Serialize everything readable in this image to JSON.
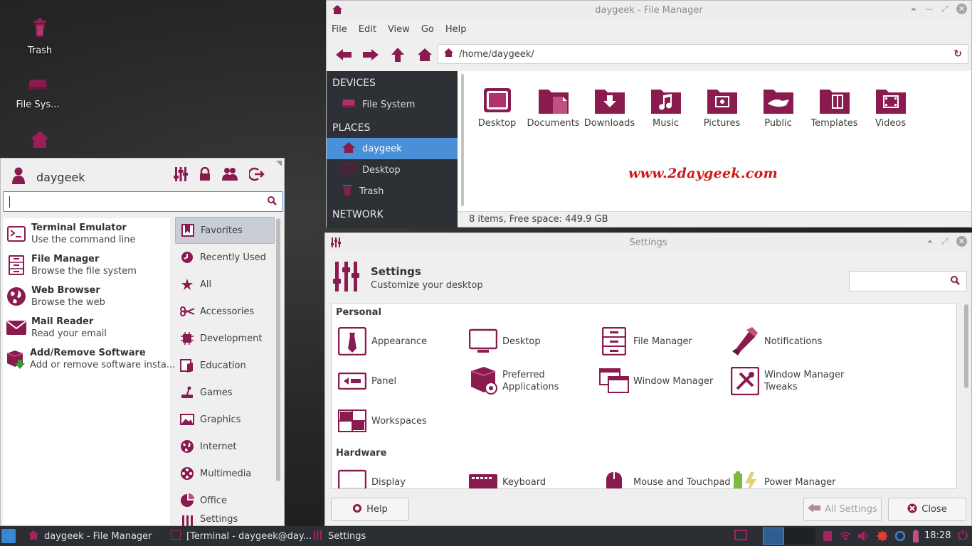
{
  "desktop": {
    "icons": [
      {
        "label": "Trash",
        "icon": "trash-icon"
      },
      {
        "label": "File Sys...",
        "icon": "drive-icon"
      },
      {
        "label": "",
        "icon": "home-icon"
      }
    ]
  },
  "file_manager": {
    "title": "daygeek - File Manager",
    "menu": [
      "File",
      "Edit",
      "View",
      "Go",
      "Help"
    ],
    "path": "/home/daygeek/",
    "sidebar": {
      "devices_header": "DEVICES",
      "devices": [
        "File System"
      ],
      "places_header": "PLACES",
      "places": [
        "daygeek",
        "Desktop",
        "Trash"
      ],
      "network_header": "NETWORK",
      "selected": "daygeek"
    },
    "folders": [
      "Desktop",
      "Documents",
      "Downloads",
      "Music",
      "Pictures",
      "Public",
      "Templates",
      "Videos"
    ],
    "watermark": "www.2daygeek.com",
    "status": "8 items, Free space: 449.9 GB"
  },
  "settings": {
    "window_title": "Settings",
    "header_title": "Settings",
    "header_subtitle": "Customize your desktop",
    "groups": {
      "personal": "Personal",
      "hardware": "Hardware"
    },
    "personal_items": [
      "Appearance",
      "Desktop",
      "File Manager",
      "Notifications",
      "Panel",
      "Preferred Applications",
      "Window Manager",
      "Window Manager Tweaks",
      "Workspaces"
    ],
    "hardware_items": [
      "Display",
      "Keyboard",
      "Mouse and Touchpad",
      "Power Manager"
    ],
    "buttons": {
      "help": "Help",
      "all_settings": "All Settings",
      "close": "Close"
    }
  },
  "menu": {
    "user": "daygeek",
    "search_value": "",
    "apps": [
      {
        "name": "Terminal Emulator",
        "desc": "Use the command line"
      },
      {
        "name": "File Manager",
        "desc": "Browse the file system"
      },
      {
        "name": "Web Browser",
        "desc": "Browse the web"
      },
      {
        "name": "Mail Reader",
        "desc": "Read your email"
      },
      {
        "name": "Add/Remove Software",
        "desc": "Add or remove software insta..."
      }
    ],
    "categories": [
      "Favorites",
      "Recently Used",
      "All",
      "Accessories",
      "Development",
      "Education",
      "Games",
      "Graphics",
      "Internet",
      "Multimedia",
      "Office",
      "Settings"
    ],
    "selected_category": "Favorites"
  },
  "taskbar": {
    "tasks": [
      "daygeek - File Manager",
      "[Terminal - daygeek@day...",
      "Settings"
    ],
    "clock": "18:28"
  },
  "colors": {
    "accent": "#8a1b4e",
    "selection": "#4a90d9",
    "watermark": "#d01919"
  }
}
